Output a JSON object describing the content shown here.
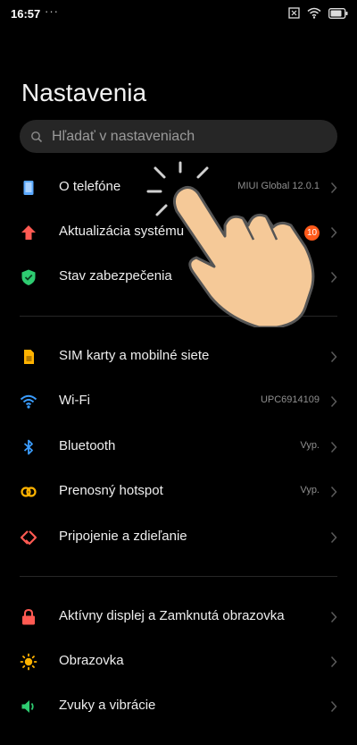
{
  "status_bar": {
    "time": "16:57",
    "dots": "···",
    "icons": [
      "screen-rotation-icon",
      "wifi-icon",
      "battery-icon"
    ]
  },
  "page": {
    "title": "Nastavenia"
  },
  "search": {
    "placeholder": "Hľadať v nastaveniach"
  },
  "colors": {
    "background": "#000000",
    "search_bg": "#262626",
    "badge": "#ff5a1a",
    "about_icon": "#5aa9ff",
    "update_icon": "#ff5a52",
    "security_icon": "#2ecc71",
    "sim_icon": "#ffb300",
    "wifi_icon": "#3b9dff",
    "bluetooth_icon": "#3b9dff",
    "hotspot_icon": "#ffb300",
    "share_icon": "#ff5a52",
    "lock_icon": "#ff5a52",
    "display_icon": "#ffb300",
    "sound_icon": "#2ecc71"
  },
  "sections": [
    {
      "items": [
        {
          "label": "O telefóne",
          "value": "MIUI Global 12.0.1",
          "icon": "phone-icon"
        },
        {
          "label": "Aktualizácia systému",
          "badge": "10",
          "icon": "arrow-up-icon"
        },
        {
          "label": "Stav zabezpečenia",
          "icon": "shield-check-icon"
        }
      ]
    },
    {
      "items": [
        {
          "label": "SIM karty a mobilné siete",
          "icon": "sim-card-icon"
        },
        {
          "label": "Wi-Fi",
          "value": "UPC6914109",
          "icon": "wifi-icon"
        },
        {
          "label": "Bluetooth",
          "value": "Vyp.",
          "icon": "bluetooth-icon"
        },
        {
          "label": "Prenosný hotspot",
          "value": "Vyp.",
          "icon": "hotspot-icon"
        },
        {
          "label": "Pripojenie a zdieľanie",
          "icon": "share-icon"
        }
      ]
    },
    {
      "items": [
        {
          "label": "Aktívny displej a Zamknutá obrazovka",
          "icon": "lock-icon"
        },
        {
          "label": "Obrazovka",
          "icon": "sun-icon"
        },
        {
          "label": "Zvuky a vibrácie",
          "icon": "speaker-icon"
        }
      ]
    }
  ]
}
